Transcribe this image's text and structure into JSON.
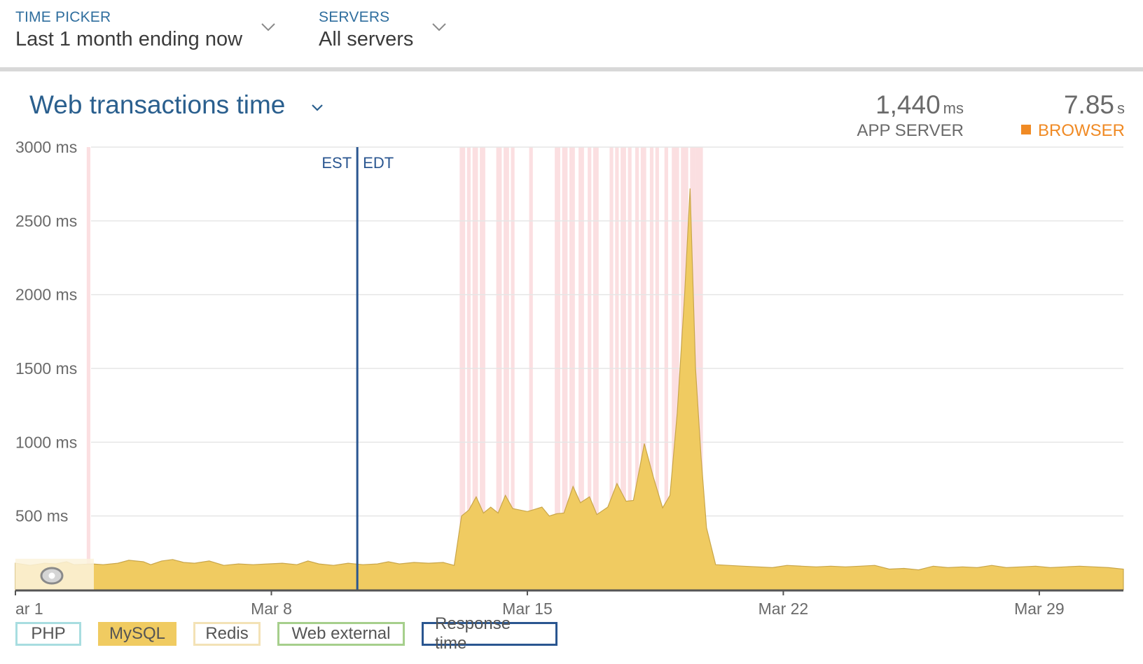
{
  "filters": {
    "time_picker": {
      "label": "TIME PICKER",
      "value": "Last 1 month ending now"
    },
    "servers": {
      "label": "SERVERS",
      "value": "All servers"
    }
  },
  "chart_header": {
    "title": "Web transactions time",
    "app_server": {
      "value": "1,440",
      "unit": "ms",
      "label": "APP SERVER"
    },
    "browser": {
      "value": "7.85",
      "unit": "s",
      "label": "BROWSER",
      "color": "#f08a24"
    }
  },
  "chart_data": {
    "type": "area",
    "title": "Web transactions time",
    "yunit": "ms",
    "ylim": [
      0,
      3000
    ],
    "y_ticks": [
      {
        "value": 3000,
        "label": "3000 ms"
      },
      {
        "value": 2500,
        "label": "2500 ms"
      },
      {
        "value": 2000,
        "label": "2000 ms"
      },
      {
        "value": 1500,
        "label": "1500 ms"
      },
      {
        "value": 1000,
        "label": "1000 ms"
      },
      {
        "value": 500,
        "label": "500 ms"
      }
    ],
    "x_range_days": [
      1,
      31.3
    ],
    "x_ticks": [
      {
        "day": 1,
        "label": "ar 1"
      },
      {
        "day": 8,
        "label": "Mar 8"
      },
      {
        "day": 15,
        "label": "Mar 15"
      },
      {
        "day": 22,
        "label": "Mar 22"
      },
      {
        "day": 29,
        "label": "Mar 29"
      }
    ],
    "grid": true,
    "legend_position": "bottom-left",
    "series": [
      {
        "name": "MySQL",
        "color": "#f0cb61",
        "points": [
          [
            1.0,
            180
          ],
          [
            1.4,
            165
          ],
          [
            1.8,
            180
          ],
          [
            2.1,
            175
          ],
          [
            2.4,
            190
          ],
          [
            2.6,
            170
          ],
          [
            2.8,
            172
          ],
          [
            3.1,
            175
          ],
          [
            3.4,
            170
          ],
          [
            3.8,
            180
          ],
          [
            4.1,
            200
          ],
          [
            4.5,
            190
          ],
          [
            4.7,
            170
          ],
          [
            5.0,
            195
          ],
          [
            5.3,
            205
          ],
          [
            5.6,
            185
          ],
          [
            5.9,
            180
          ],
          [
            6.3,
            195
          ],
          [
            6.7,
            165
          ],
          [
            7.1,
            175
          ],
          [
            7.5,
            170
          ],
          [
            7.9,
            175
          ],
          [
            8.3,
            180
          ],
          [
            8.7,
            170
          ],
          [
            9.0,
            195
          ],
          [
            9.3,
            175
          ],
          [
            9.7,
            165
          ],
          [
            10.1,
            180
          ],
          [
            10.5,
            170
          ],
          [
            10.9,
            175
          ],
          [
            11.2,
            190
          ],
          [
            11.5,
            175
          ],
          [
            11.9,
            185
          ],
          [
            12.3,
            180
          ],
          [
            12.7,
            185
          ],
          [
            13.0,
            165
          ],
          [
            13.2,
            500
          ],
          [
            13.4,
            540
          ],
          [
            13.6,
            630
          ],
          [
            13.8,
            520
          ],
          [
            14.0,
            560
          ],
          [
            14.2,
            520
          ],
          [
            14.4,
            640
          ],
          [
            14.6,
            550
          ],
          [
            14.8,
            540
          ],
          [
            15.0,
            530
          ],
          [
            15.2,
            545
          ],
          [
            15.4,
            560
          ],
          [
            15.6,
            500
          ],
          [
            15.8,
            515
          ],
          [
            16.0,
            520
          ],
          [
            16.25,
            700
          ],
          [
            16.45,
            590
          ],
          [
            16.7,
            630
          ],
          [
            16.9,
            510
          ],
          [
            17.2,
            560
          ],
          [
            17.45,
            720
          ],
          [
            17.7,
            600
          ],
          [
            17.9,
            605
          ],
          [
            18.2,
            990
          ],
          [
            18.45,
            760
          ],
          [
            18.7,
            555
          ],
          [
            18.9,
            640
          ],
          [
            19.1,
            1200
          ],
          [
            19.3,
            2000
          ],
          [
            19.45,
            2720
          ],
          [
            19.6,
            1500
          ],
          [
            19.75,
            900
          ],
          [
            19.9,
            420
          ],
          [
            20.15,
            170
          ],
          [
            20.5,
            165
          ],
          [
            20.9,
            160
          ],
          [
            21.3,
            155
          ],
          [
            21.7,
            150
          ],
          [
            22.1,
            165
          ],
          [
            22.5,
            160
          ],
          [
            22.9,
            155
          ],
          [
            23.3,
            160
          ],
          [
            23.7,
            155
          ],
          [
            24.1,
            160
          ],
          [
            24.5,
            165
          ],
          [
            24.9,
            140
          ],
          [
            25.3,
            145
          ],
          [
            25.7,
            135
          ],
          [
            26.1,
            160
          ],
          [
            26.5,
            150
          ],
          [
            26.9,
            155
          ],
          [
            27.3,
            150
          ],
          [
            27.7,
            165
          ],
          [
            28.1,
            150
          ],
          [
            28.5,
            155
          ],
          [
            28.9,
            160
          ],
          [
            29.3,
            150
          ],
          [
            29.7,
            155
          ],
          [
            30.1,
            160
          ],
          [
            30.5,
            155
          ],
          [
            30.9,
            150
          ],
          [
            31.1,
            145
          ],
          [
            31.3,
            140
          ]
        ]
      }
    ],
    "annotation": {
      "day": 10.35,
      "labels": [
        "EST",
        "EDT"
      ]
    },
    "error_bands_days": [
      [
        2.95,
        3.05
      ],
      [
        13.15,
        13.3
      ],
      [
        13.35,
        13.45
      ],
      [
        13.5,
        13.65
      ],
      [
        13.7,
        13.85
      ],
      [
        14.15,
        14.3
      ],
      [
        14.35,
        14.5
      ],
      [
        14.55,
        14.65
      ],
      [
        15.05,
        15.15
      ],
      [
        15.75,
        15.9
      ],
      [
        15.95,
        16.1
      ],
      [
        16.15,
        16.3
      ],
      [
        16.4,
        16.55
      ],
      [
        16.65,
        16.75
      ],
      [
        16.8,
        16.95
      ],
      [
        17.25,
        17.35
      ],
      [
        17.4,
        17.5
      ],
      [
        17.55,
        17.7
      ],
      [
        17.75,
        17.85
      ],
      [
        17.95,
        18.05
      ],
      [
        18.1,
        18.25
      ],
      [
        18.35,
        18.45
      ],
      [
        18.5,
        18.6
      ],
      [
        18.75,
        18.85
      ],
      [
        18.95,
        19.15
      ],
      [
        19.2,
        19.4
      ],
      [
        19.45,
        19.6
      ],
      [
        19.6,
        19.8
      ]
    ],
    "zoom_handle_icon": "eye-icon"
  },
  "legend": {
    "items": [
      {
        "label": "PHP",
        "color": "#a8dde0",
        "filled": false
      },
      {
        "label": "MySQL",
        "color": "#f0cb61",
        "filled": true
      },
      {
        "label": "Redis",
        "color": "#f3e2b6",
        "filled": false
      },
      {
        "label": "Web external",
        "color": "#a6cf8c",
        "filled": false
      },
      {
        "label": "Response time",
        "color": "#2a5690",
        "filled": false
      }
    ]
  }
}
